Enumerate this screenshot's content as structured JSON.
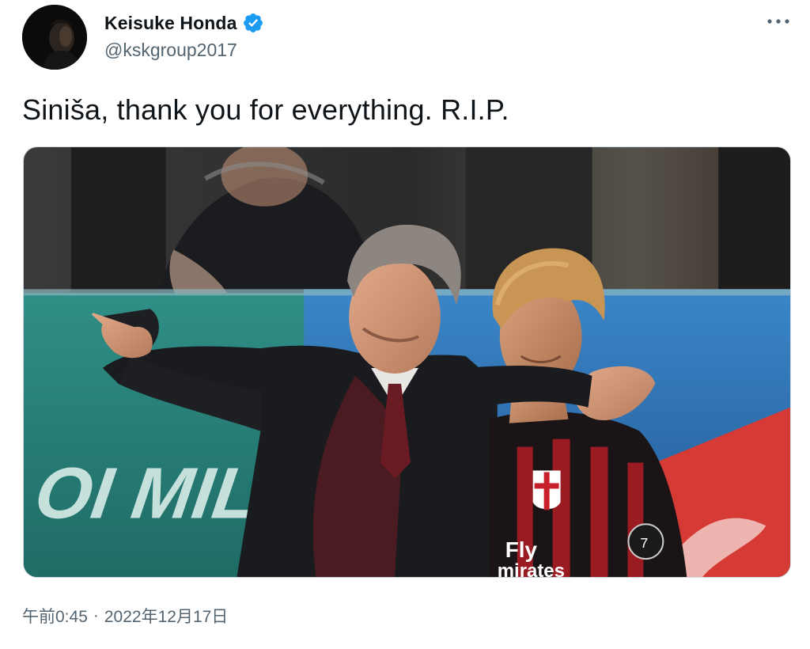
{
  "author": {
    "display_name": "Keisuke Honda",
    "handle": "@kskgroup2017",
    "verified": true,
    "verified_color": "#1d9bf0",
    "avatar_icon": "profile-photo"
  },
  "more_icon": "ellipsis-icon",
  "tweet": {
    "text": "Siniša, thank you for everything. R.I.P."
  },
  "media": {
    "alt": "Photo of coach pointing with arm around player in AC Milan kit",
    "banner_text": "E OI MILANO"
  },
  "meta": {
    "time": "午前0:45",
    "separator": "·",
    "date": "2022年12月17日"
  }
}
